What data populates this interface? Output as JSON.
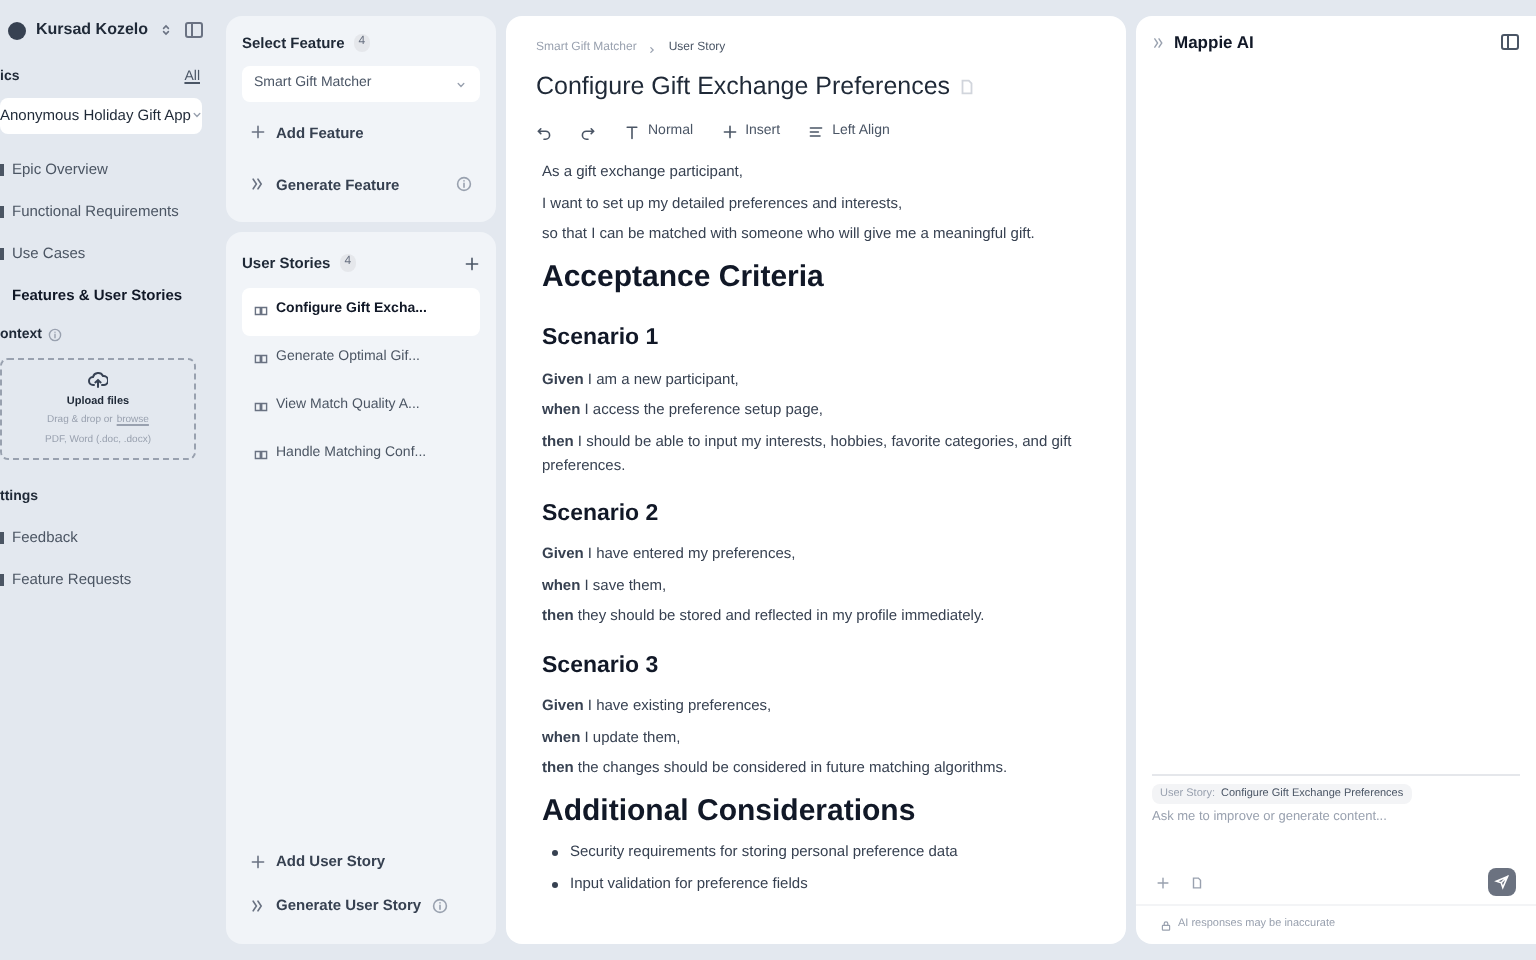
{
  "sidebar": {
    "user": "Kursad Kozelo",
    "section_title": "ics",
    "all_link": "All",
    "project": "Anonymous Holiday Gift App",
    "nav": [
      {
        "label": "Epic Overview",
        "selected": false
      },
      {
        "label": "Functional Requirements",
        "selected": false
      },
      {
        "label": "Use Cases",
        "selected": false
      },
      {
        "label": "Features & User Stories",
        "selected": true
      }
    ],
    "context_title": "ontext",
    "upload": {
      "title": "Upload files",
      "hint": "Drag & drop or",
      "link": "browse",
      "formats": "PDF, Word (.doc, .docx)"
    },
    "settings_title": "ttings",
    "settings": [
      "Feedback",
      "Feature Requests"
    ]
  },
  "features": {
    "title": "Select Feature",
    "count": "4",
    "select": "Smart Gift Matcher",
    "actions": [
      {
        "kind": "add",
        "label": "Add Feature"
      },
      {
        "kind": "generate",
        "label": "Generate Feature"
      }
    ]
  },
  "stories": {
    "title": "User Stories",
    "count": "4",
    "items": [
      {
        "label": "Configure Gift Excha...",
        "selected": true
      },
      {
        "label": "Generate Optimal Gif...",
        "selected": false
      },
      {
        "label": "View Match Quality A...",
        "selected": false
      },
      {
        "label": "Handle Matching Conf...",
        "selected": false
      }
    ],
    "actions": [
      {
        "kind": "add",
        "label": "Add User Story"
      },
      {
        "kind": "generate",
        "label": "Generate User Story"
      }
    ]
  },
  "editor": {
    "breadcrumb": [
      "Smart Gift Matcher",
      "User Story"
    ],
    "title": "Configure Gift Exchange Preferences",
    "toolbar": [
      {
        "kind": "undo"
      },
      {
        "kind": "redo"
      },
      {
        "kind": "text",
        "label": "Normal"
      },
      {
        "kind": "insert",
        "label": "Insert"
      },
      {
        "kind": "align",
        "label": "Left Align"
      }
    ],
    "blocks": [
      {
        "kind": "p",
        "text": "As a gift exchange participant,"
      },
      {
        "kind": "p",
        "text": "I want to set up my detailed preferences and interests,"
      },
      {
        "kind": "p",
        "text": "so that I can be matched with someone who will give me a meaningful gift."
      },
      {
        "kind": "h1",
        "text": "Acceptance Criteria"
      },
      {
        "kind": "h2",
        "text": "Scenario 1"
      },
      {
        "kind": "p",
        "text": "**Given** I am a new participant,"
      },
      {
        "kind": "p",
        "text": "**when** I access the preference setup page,"
      },
      {
        "kind": "p",
        "text": "**then** I should be able to input my interests, hobbies, favorite categories, and gift preferences."
      },
      {
        "kind": "h2",
        "text": "Scenario 2"
      },
      {
        "kind": "p",
        "text": "**Given** I have entered my preferences,"
      },
      {
        "kind": "p",
        "text": "**when** I save them,"
      },
      {
        "kind": "p",
        "text": "**then** they should be stored and reflected in my profile immediately."
      },
      {
        "kind": "h2",
        "text": "Scenario 3"
      },
      {
        "kind": "p",
        "text": "**Given** I have existing preferences,"
      },
      {
        "kind": "p",
        "text": "**when** I update them,"
      },
      {
        "kind": "p",
        "text": "**then** the changes should be considered in future matching algorithms."
      },
      {
        "kind": "h1",
        "text": "Additional Considerations"
      },
      {
        "kind": "li",
        "text": "Security requirements for storing personal preference data"
      },
      {
        "kind": "li",
        "text": "Input validation for preference fields"
      }
    ]
  },
  "assistant": {
    "title": "Mappie AI",
    "context_label": "User Story:",
    "context_value": "Configure Gift Exchange Preferences",
    "placeholder": "Ask me to improve or generate content...",
    "disclaimer": "AI responses may be inaccurate"
  }
}
